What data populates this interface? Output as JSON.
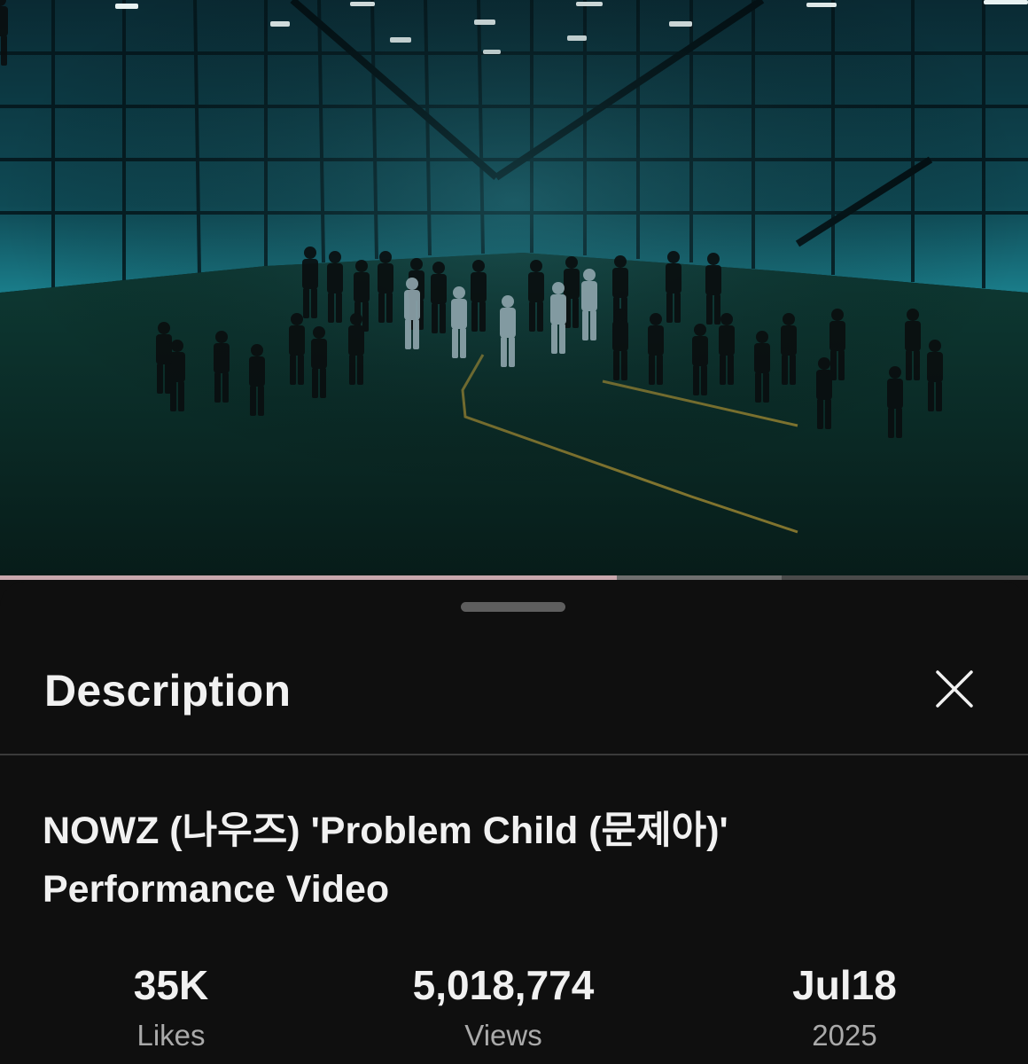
{
  "player": {
    "progress_fraction": 0.6,
    "buffer_fraction": 0.76
  },
  "description_panel": {
    "header_title": "Description",
    "close_icon": "close-icon",
    "video_title_line1": "NOWZ (나우즈) 'Problem Child (문제아)'",
    "video_title_line2": "Performance Video",
    "stats": [
      {
        "value": "35K",
        "label": "Likes"
      },
      {
        "value": "5,018,774",
        "label": "Views"
      },
      {
        "value": "Jul18",
        "label": "2025"
      }
    ]
  },
  "colors": {
    "background": "#0f0f0f",
    "text_primary": "#f1f1f1",
    "text_secondary": "#aaaaaa",
    "progress_played": "#c9a8ae"
  }
}
